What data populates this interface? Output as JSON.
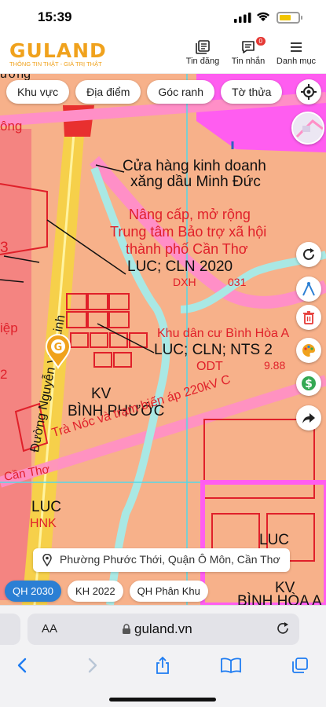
{
  "status_bar": {
    "time": "15:39"
  },
  "header": {
    "brand": "GULAND",
    "tagline": "THÔNG TIN THẬT - GIÁ TRỊ THẬT",
    "nav": [
      {
        "label": "Tin đăng",
        "icon": "listings-icon"
      },
      {
        "label": "Tin nhắn",
        "icon": "message-icon",
        "badge": "0"
      },
      {
        "label": "Danh mục",
        "icon": "menu-icon"
      }
    ]
  },
  "map": {
    "filters": [
      "Khu vực",
      "Địa điểm",
      "Góc ranh",
      "Tờ thửa"
    ],
    "labels": {
      "store": "Cửa hàng kinh doanh",
      "gas": "xăng dầu Minh Đức",
      "upgrade1": "Nâng cấp, mở rộng",
      "upgrade2": "Trung tâm Bảo trợ xã hội",
      "upgrade3": "thành phố Cần Thơ",
      "luc_cln": "LUC; CLN 2020",
      "dxh": "DXH",
      "num031": "031",
      "khu_dan_cu": "Khu dân cư Bình Hòa A",
      "luc_cln_nts": "LUC; CLN; NTS 2",
      "odt": "ODT",
      "num988": "9.88",
      "kv": "KV",
      "binh_phuoc": "BÌNH PHƯỚC",
      "tram": "Trà Nóc và trạm biến áp 220kV C",
      "road": "Đường Nguyễn Văn Linh",
      "can_tho": "Cần Thơ",
      "luc_left": "LUC",
      "hnk": "HNK",
      "luc_right": "LUC",
      "kv_right": "KV",
      "binh_hoa": "BÌNH HÒA A",
      "ong": "ông",
      "num3": "3",
      "nep": "iệp",
      "num2": "2",
      "number_left": "ương"
    },
    "address": "Phường Phước Thới, Quận Ô Môn, Cần Thơ",
    "plan_tabs": [
      {
        "label": "QH 2030",
        "active": true
      },
      {
        "label": "KH 2022",
        "active": false
      },
      {
        "label": "QH Phân Khu",
        "active": false
      }
    ]
  },
  "browser": {
    "aa": "AA",
    "url": "guland.vn"
  },
  "colors": {
    "accent": "#f0a21d",
    "active_tab": "#2b7fd4",
    "map_residential": "#f7b18a",
    "map_red": "#e0202a",
    "map_magenta": "#ff5df0"
  }
}
